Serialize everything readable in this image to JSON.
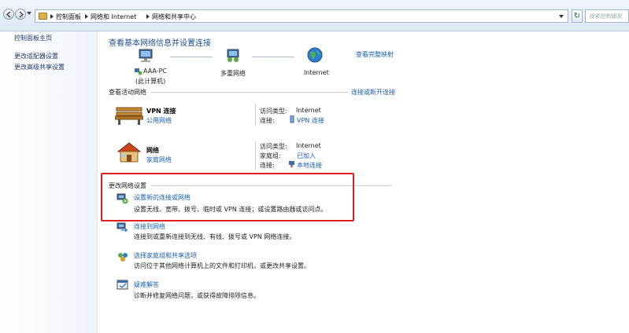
{
  "address_bar": {
    "breadcrumbs": [
      "控制面板",
      "网络和 Internet",
      "网络和共享中心"
    ],
    "search_placeholder": "搜索控制面板"
  },
  "left_panel": {
    "links": [
      "控制面板主页",
      "更改适配器设置",
      "更改高级共享设置"
    ]
  },
  "main": {
    "title": "查看基本网络信息并设置连接",
    "view_full_map": "查看完整映射",
    "map": {
      "computer_name": "AAA-PC",
      "computer_sub": "(此计算机)",
      "middle": "多重网络",
      "internet": "Internet"
    },
    "active_networks": {
      "heading": "查看活动网络",
      "connect_link": "连接或断开连接",
      "networks": [
        {
          "name": "VPN 连接",
          "type_link": "公用网络",
          "access_type_label": "访问类型:",
          "access_type_value": "Internet",
          "connection_label": "连接:",
          "connection_value": "VPN 连接"
        },
        {
          "name": "网络",
          "type_link": "家庭网络",
          "access_type_label": "访问类型:",
          "access_type_value": "Internet",
          "homegroup_label": "家庭组:",
          "homegroup_value": "已加入",
          "connection_label": "连接:",
          "connection_value": "本地连接"
        }
      ]
    },
    "change_settings": {
      "heading": "更改网络设置",
      "items": [
        {
          "title": "设置新的连接或网络",
          "desc": "设置无线、宽带、拨号、临时或 VPN 连接；或设置路由器或访问点。"
        },
        {
          "title": "连接到网络",
          "desc": "连接到或重新连接到无线、有线、拨号或 VPN 网络连接。"
        },
        {
          "title": "选择家庭组和共享选项",
          "desc": "访问位于其他网络计算机上的文件和打印机，或更改共享设置。"
        },
        {
          "title": "疑难解答",
          "desc": "诊断并修复网络问题，或获得故障排除信息。"
        }
      ]
    }
  },
  "colors": {
    "link": "#1a5fb4",
    "title": "#1e4e8c",
    "highlight": "#e02020"
  }
}
